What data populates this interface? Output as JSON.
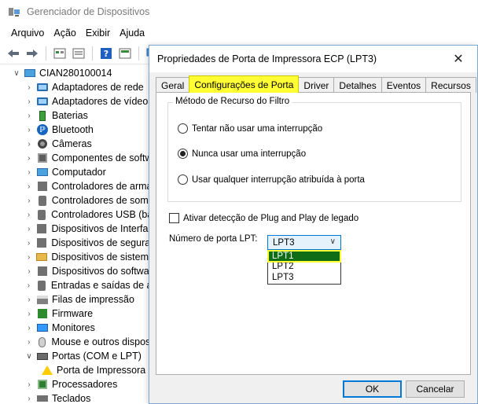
{
  "device_manager": {
    "title": "Gerenciador de Dispositivos",
    "menu": [
      "Arquivo",
      "Ação",
      "Exibir",
      "Ajuda"
    ],
    "tree": {
      "root": "CIAN280100014",
      "items": [
        {
          "label": "Adaptadores de rede",
          "icon": "network-adapter-icon"
        },
        {
          "label": "Adaptadores de vídeo",
          "icon": "display-adapter-icon"
        },
        {
          "label": "Baterias",
          "icon": "battery-icon"
        },
        {
          "label": "Bluetooth",
          "icon": "bluetooth-icon"
        },
        {
          "label": "Câmeras",
          "icon": "camera-icon"
        },
        {
          "label": "Componentes de softw",
          "icon": "software-component-icon"
        },
        {
          "label": "Computador",
          "icon": "computer-icon"
        },
        {
          "label": "Controladores de arma",
          "icon": "storage-controller-icon"
        },
        {
          "label": "Controladores de som,",
          "icon": "sound-controller-icon"
        },
        {
          "label": "Controladores USB (bar",
          "icon": "usb-controller-icon"
        },
        {
          "label": "Dispositivos de Interfac",
          "icon": "hid-icon"
        },
        {
          "label": "Dispositivos de segurar",
          "icon": "security-device-icon"
        },
        {
          "label": "Dispositivos de sistema",
          "icon": "system-device-icon"
        },
        {
          "label": "Dispositivos do softwa",
          "icon": "software-device-icon"
        },
        {
          "label": "Entradas e saídas de áu",
          "icon": "audio-io-icon"
        },
        {
          "label": "Filas de impressão",
          "icon": "print-queue-icon"
        },
        {
          "label": "Firmware",
          "icon": "firmware-icon"
        },
        {
          "label": "Monitores",
          "icon": "monitor-icon"
        },
        {
          "label": "Mouse e outros disposi",
          "icon": "mouse-icon"
        },
        {
          "label": "Portas (COM e LPT)",
          "icon": "port-icon",
          "expanded": true
        },
        {
          "label": "Porta de Impressora",
          "icon": "warning-printer-port-icon",
          "child": true
        },
        {
          "label": "Processadores",
          "icon": "processor-icon"
        },
        {
          "label": "Teclados",
          "icon": "keyboard-icon"
        }
      ]
    }
  },
  "dialog": {
    "title": "Propriedades de Porta de Impressora ECP (LPT3)",
    "tabs": [
      "Geral",
      "Configurações de Porta",
      "Driver",
      "Detalhes",
      "Eventos",
      "Recursos"
    ],
    "active_tab": 1,
    "group_title": "Método de Recurso do Filtro",
    "radio_options": [
      {
        "label": "Tentar não usar uma interrupção",
        "checked": false
      },
      {
        "label": "Nunca usar uma interrupção",
        "checked": true
      },
      {
        "label": "Usar qualquer interrupção atribuída à porta",
        "checked": false
      }
    ],
    "legacy_pnp_label": "Ativar detecção de Plug and Play de legado",
    "legacy_pnp_checked": false,
    "lpt_label": "Número de porta LPT:",
    "lpt_selected": "LPT3",
    "lpt_options": [
      "LPT1",
      "LPT2",
      "LPT3"
    ],
    "lpt_highlighted": "LPT1",
    "ok_label": "OK",
    "cancel_label": "Cancelar"
  },
  "colors": {
    "highlight_yellow": "#ffff33",
    "selection_green": "#0f6d16",
    "focus_blue": "#0078d7"
  }
}
